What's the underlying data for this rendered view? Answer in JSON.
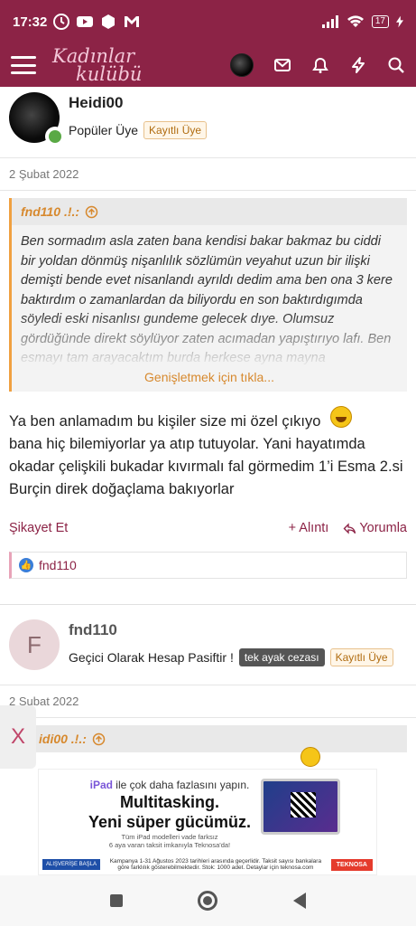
{
  "status_bar": {
    "time": "17:32",
    "battery": "17"
  },
  "app": {
    "logo_line1": "Kadınlar",
    "logo_line2": "kulübü"
  },
  "post1": {
    "username": "Heidi00",
    "user_title": "Popüler Üye",
    "badge": "Kayıtlı Üye",
    "date": "2 Şubat 2022",
    "quote_author": "fnd110 .!.:",
    "quote_text": "Ben sormadım asla zaten bana kendisi bakar bakmaz bu ciddi bir yoldan dönmüş nişanlılık sözlümün veyahut uzun bir ilişki demişti bende evet nisanlandı ayrıldı dedim ama ben ona 3 kere baktırdım o zamanlardan da biliyordu en son baktırdıgımda söyledi eski nisanlısı gundeme gelecek dıye. Olumsuz gördüğünde direkt söylüyor zaten acımadan yapıştırıyo lafı. Ben esmayı tam arayacaktım burda herkese ayna mayna",
    "expand_label": "Genişletmek için tıkla...",
    "message": "Ya ben anlamadım bu kişiler size mi özel çıkıyo",
    "message2": "bana hiç bilemiyorlar ya atıp tutuyolar. Yani hayatımda okadar çelişkili bukadar kıvırmalı fal görmedim 1’i Esma 2.si Burçin direk doğaçlama bakıyorlar",
    "report_label": "Şikayet Et",
    "quote_label": "+ Alıntı",
    "reply_label": "Yorumla",
    "reaction_user": "fnd110"
  },
  "post2": {
    "avatar_letter": "F",
    "username": "fnd110",
    "user_title": "Geçici Olarak Hesap Pasiftir !",
    "penalty_badge": "tek ayak cezası",
    "badge": "Kayıtlı Üye",
    "date": "2 Şubat 2022",
    "quote_author": "idi00 .!.:"
  },
  "ad": {
    "close_label": "X",
    "line1_brand": "iPad",
    "line1": "ile çok daha fazlasını yapın.",
    "headline1": "Multitasking.",
    "headline2": "Yeni süper gücümüz.",
    "small1": "Tüm iPad modelleri vade farksız",
    "small2": "6 aya varan taksit imkanıyla Teknosa'da!",
    "cta": "ALIŞVERİŞE BAŞLA",
    "campaign": "Kampanya 1-31 Ağustos 2023 tarihleri arasında geçerlidir. Taksit sayısı bankalara göre farklılık gösterebilmektedir. Stok: 1000 adet. Detaylar için teknosa.com",
    "brand": "TEKNOSA"
  }
}
